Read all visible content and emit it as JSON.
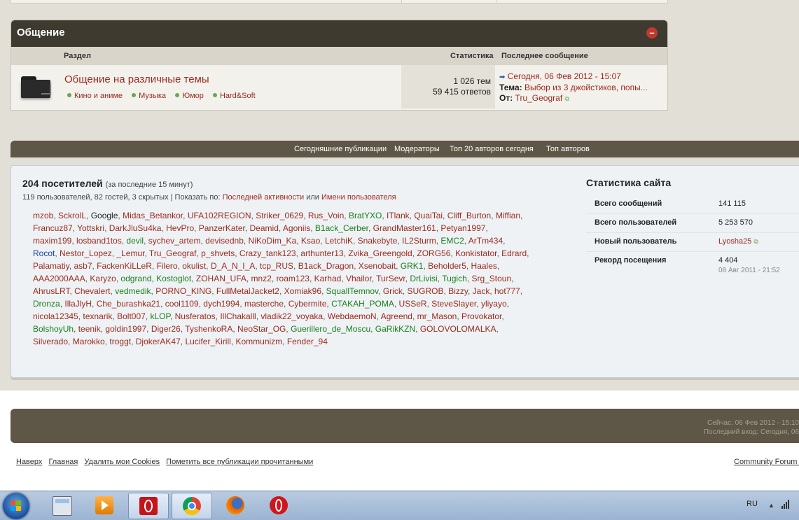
{
  "category": {
    "title": "Общение",
    "collapse_glyph": "–",
    "col_section": "Раздел",
    "col_stats": "Статистика",
    "col_last": "Последнее сообщение",
    "forum": {
      "title": "Общение на различные темы",
      "subforums": [
        "Кино и аниме",
        "Музыка",
        "Юмор",
        "Hard&Soft"
      ],
      "topics": "1 026 тем",
      "replies": "59 415 ответов",
      "last_date": "Сегодня, 06 Фев 2012 - 15:07",
      "last_topic_label": "Тема:",
      "last_topic": "Выбор из 3 джойстиков, попы...",
      "last_from_label": "От:",
      "last_from": "Tru_Geograf"
    }
  },
  "navbar": {
    "items": [
      "Сегодняшние публикации",
      "Модераторы",
      "Топ 20 авторов сегодня",
      "Топ авторов"
    ]
  },
  "online": {
    "count_title": "204 посетителей",
    "period": "(за последние 15 минут)",
    "summary": "119 пользователей, 82 гостей, 3 скрытых | Показать по:",
    "sort_activity": "Последней активности",
    "sort_or": "или",
    "sort_name": "Имени пользователя",
    "users": [
      {
        "n": "mzob",
        "c": "red"
      },
      {
        "n": "SckrolL",
        "c": "red"
      },
      {
        "n": "Google",
        "c": "black"
      },
      {
        "n": "Midas_Betankor",
        "c": "red"
      },
      {
        "n": "UFA102REGION",
        "c": "red"
      },
      {
        "n": "Striker_0629",
        "c": "red"
      },
      {
        "n": "Rus_Voin",
        "c": "red"
      },
      {
        "n": "BratYXO",
        "c": "green"
      },
      {
        "n": "ITlank",
        "c": "red"
      },
      {
        "n": "QuaiTai",
        "c": "red"
      },
      {
        "n": "Cliff_Burton",
        "c": "red"
      },
      {
        "n": "Miffian",
        "c": "red"
      },
      {
        "n": "Francuz87",
        "c": "red"
      },
      {
        "n": "Yottskri",
        "c": "red"
      },
      {
        "n": "DarkJluSu4ka",
        "c": "red"
      },
      {
        "n": "HevPro",
        "c": "red"
      },
      {
        "n": "PanzerKater",
        "c": "red"
      },
      {
        "n": "Deamid",
        "c": "red"
      },
      {
        "n": "Agoniis",
        "c": "red"
      },
      {
        "n": "B1ack_Cerber",
        "c": "green"
      },
      {
        "n": "GrandMaster161",
        "c": "red"
      },
      {
        "n": "Petyan1997",
        "c": "red"
      },
      {
        "n": "maxim199",
        "c": "red"
      },
      {
        "n": "losband1tos",
        "c": "red"
      },
      {
        "n": "devil",
        "c": "green"
      },
      {
        "n": "sychev_artem",
        "c": "red"
      },
      {
        "n": "devisednb",
        "c": "red"
      },
      {
        "n": "NiKoDim_Ka",
        "c": "red"
      },
      {
        "n": "Ksao",
        "c": "red"
      },
      {
        "n": "LetchiK",
        "c": "red"
      },
      {
        "n": "Snakebyte",
        "c": "red"
      },
      {
        "n": "IL2Sturm",
        "c": "red"
      },
      {
        "n": "EMC2",
        "c": "green"
      },
      {
        "n": "ArTm434",
        "c": "red"
      },
      {
        "n": "Rocot",
        "c": "blue"
      },
      {
        "n": "Nestor_Lopez",
        "c": "red"
      },
      {
        "n": "_Lemur",
        "c": "red"
      },
      {
        "n": "Tru_Geograf",
        "c": "red"
      },
      {
        "n": "p_shvets",
        "c": "red"
      },
      {
        "n": "Crazy_tank123",
        "c": "red"
      },
      {
        "n": "arthunter13",
        "c": "red"
      },
      {
        "n": "Zvika_Greengold",
        "c": "red"
      },
      {
        "n": "ZORG56",
        "c": "red"
      },
      {
        "n": "Konkistator",
        "c": "red"
      },
      {
        "n": "Edrard",
        "c": "red"
      },
      {
        "n": "Palamatiy",
        "c": "red"
      },
      {
        "n": "asb7",
        "c": "red"
      },
      {
        "n": "FackenKiLLeR",
        "c": "red"
      },
      {
        "n": "Filero",
        "c": "red"
      },
      {
        "n": "okulist",
        "c": "red"
      },
      {
        "n": "D_A_N_I_A",
        "c": "red"
      },
      {
        "n": "tcp_RUS",
        "c": "red"
      },
      {
        "n": "B1ack_Dragon",
        "c": "red"
      },
      {
        "n": "Xsenobait",
        "c": "red"
      },
      {
        "n": "GRK1",
        "c": "green"
      },
      {
        "n": "Beholder5",
        "c": "red"
      },
      {
        "n": "Haales",
        "c": "red"
      },
      {
        "n": "AAA2000AAA",
        "c": "red"
      },
      {
        "n": "Karyzo",
        "c": "red"
      },
      {
        "n": "odgrand",
        "c": "green"
      },
      {
        "n": "Kostoglot",
        "c": "green"
      },
      {
        "n": "ZOHAN_UFA",
        "c": "red"
      },
      {
        "n": "mnz2",
        "c": "red"
      },
      {
        "n": "roam123",
        "c": "red"
      },
      {
        "n": "Karhad",
        "c": "red"
      },
      {
        "n": "Vhailor",
        "c": "red"
      },
      {
        "n": "TurSevr",
        "c": "red"
      },
      {
        "n": "DrLivisi",
        "c": "green"
      },
      {
        "n": "Tugich",
        "c": "green"
      },
      {
        "n": "Srg_Stoun",
        "c": "red"
      },
      {
        "n": "AhrusLRT",
        "c": "red"
      },
      {
        "n": "Chevalert",
        "c": "red"
      },
      {
        "n": "vedmedik",
        "c": "green"
      },
      {
        "n": "PORNO_KING",
        "c": "red"
      },
      {
        "n": "FullMetalJacket2",
        "c": "red"
      },
      {
        "n": "Xomiak96",
        "c": "red"
      },
      {
        "n": "SquallTemnov",
        "c": "green"
      },
      {
        "n": "Grick",
        "c": "red"
      },
      {
        "n": "SUGROB",
        "c": "red"
      },
      {
        "n": "Bizzy",
        "c": "red"
      },
      {
        "n": "Jack",
        "c": "red"
      },
      {
        "n": "hot777",
        "c": "red"
      },
      {
        "n": "Dronza",
        "c": "green"
      },
      {
        "n": "IllaJlyH",
        "c": "red"
      },
      {
        "n": "Che_burashka21",
        "c": "red"
      },
      {
        "n": "cool1109",
        "c": "red"
      },
      {
        "n": "dych1994",
        "c": "red"
      },
      {
        "n": "masterche",
        "c": "red"
      },
      {
        "n": "Cybermite",
        "c": "red"
      },
      {
        "n": "CTAKAH_POMA",
        "c": "green"
      },
      {
        "n": "USSeR",
        "c": "red"
      },
      {
        "n": "SteveSlayer",
        "c": "red"
      },
      {
        "n": "yliyayo",
        "c": "red"
      },
      {
        "n": "nicola12345",
        "c": "red"
      },
      {
        "n": "texnarik",
        "c": "red"
      },
      {
        "n": "Bolt007",
        "c": "red"
      },
      {
        "n": "kLOP",
        "c": "green"
      },
      {
        "n": "Nusferatos",
        "c": "red"
      },
      {
        "n": "IllChakalll",
        "c": "red"
      },
      {
        "n": "vladik22_voyaka",
        "c": "red"
      },
      {
        "n": "WebdaemoN",
        "c": "red"
      },
      {
        "n": "Agreend",
        "c": "red"
      },
      {
        "n": "mr_Mason",
        "c": "red"
      },
      {
        "n": "Provokator",
        "c": "red"
      },
      {
        "n": "BolshoyUh",
        "c": "green"
      },
      {
        "n": "teenik",
        "c": "red"
      },
      {
        "n": "goldin1997",
        "c": "red"
      },
      {
        "n": "Diger26",
        "c": "red"
      },
      {
        "n": "TyshenkoRA",
        "c": "red"
      },
      {
        "n": "NeoStar_OG",
        "c": "red"
      },
      {
        "n": "Guerillero_de_Moscu",
        "c": "green"
      },
      {
        "n": "GaRikKZN",
        "c": "green"
      },
      {
        "n": "GOLOVOLOMALKA",
        "c": "red"
      },
      {
        "n": "Silverado",
        "c": "red"
      },
      {
        "n": "Marokko",
        "c": "red"
      },
      {
        "n": "troggt",
        "c": "red"
      },
      {
        "n": "DjokerAK47",
        "c": "red"
      },
      {
        "n": "Lucifer_Kirill",
        "c": "red"
      },
      {
        "n": "Kommunizm",
        "c": "red"
      },
      {
        "n": "Fender_94",
        "c": "red"
      }
    ]
  },
  "site_stats": {
    "title": "Статистика сайта",
    "rows": [
      {
        "k": "Всего сообщений",
        "v": "141 115"
      },
      {
        "k": "Всего пользователей",
        "v": "5 253 570"
      },
      {
        "k": "Новый пользователь",
        "v": "Lyosha25"
      },
      {
        "k": "Рекорд посещения",
        "v": "4 404",
        "v2": "08 Авг 2011 - 21:52"
      }
    ]
  },
  "footer": {
    "now": "Сейчас: 06 Фев 2012 - 15:10",
    "last_visit": "Последний вход: Сегодня, 06",
    "links": [
      "Наверх",
      "Главная",
      "Удалить мои Cookies",
      "Пометить все публикации прочитанными"
    ],
    "community": "Community Forum S"
  },
  "taskbar": {
    "lang": "RU",
    "apps": [
      "calculator",
      "media-player",
      "opera-next",
      "chrome",
      "firefox",
      "opera"
    ]
  },
  "colors": {
    "red": "#9d2a1e",
    "green": "#1a7f1a",
    "blue": "#1d3ea8",
    "header": "#3f3a30",
    "bar": "#5e5647"
  }
}
